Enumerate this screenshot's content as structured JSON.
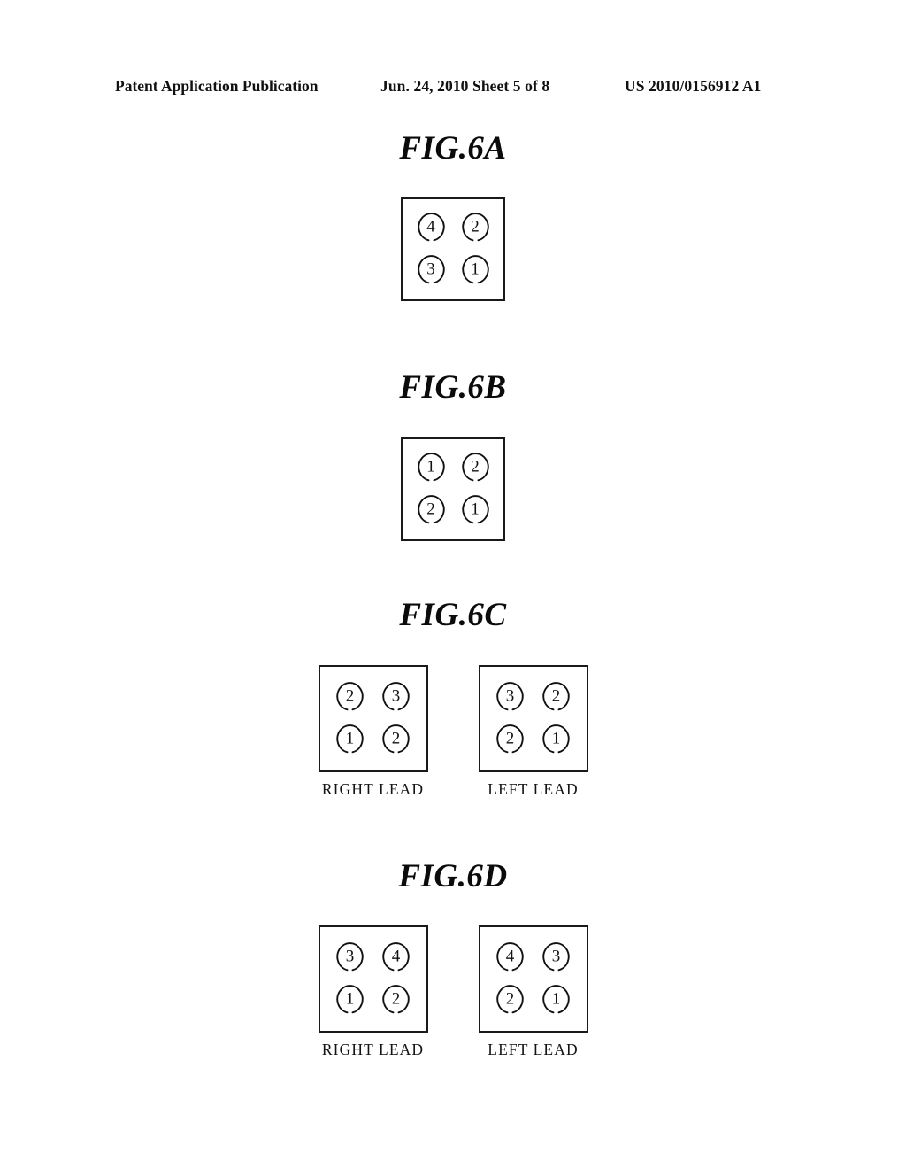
{
  "header": {
    "publication": "Patent Application Publication",
    "date_sheet": "Jun. 24, 2010  Sheet 5 of 8",
    "doc_id": "US 2010/0156912 A1"
  },
  "figures": [
    {
      "title": "FIG.6A",
      "groups": [
        {
          "label": "",
          "cells": [
            "4",
            "2",
            "3",
            "1"
          ]
        }
      ]
    },
    {
      "title": "FIG.6B",
      "groups": [
        {
          "label": "",
          "cells": [
            "1",
            "2",
            "2",
            "1"
          ]
        }
      ]
    },
    {
      "title": "FIG.6C",
      "groups": [
        {
          "label": "RIGHT LEAD",
          "cells": [
            "2",
            "3",
            "1",
            "2"
          ]
        },
        {
          "label": "LEFT LEAD",
          "cells": [
            "3",
            "2",
            "2",
            "1"
          ]
        }
      ]
    },
    {
      "title": "FIG.6D",
      "groups": [
        {
          "label": "RIGHT LEAD",
          "cells": [
            "3",
            "4",
            "1",
            "2"
          ]
        },
        {
          "label": "LEFT LEAD",
          "cells": [
            "4",
            "3",
            "2",
            "1"
          ]
        }
      ]
    }
  ],
  "colors": {
    "ink": "#111111",
    "page": "#ffffff"
  }
}
